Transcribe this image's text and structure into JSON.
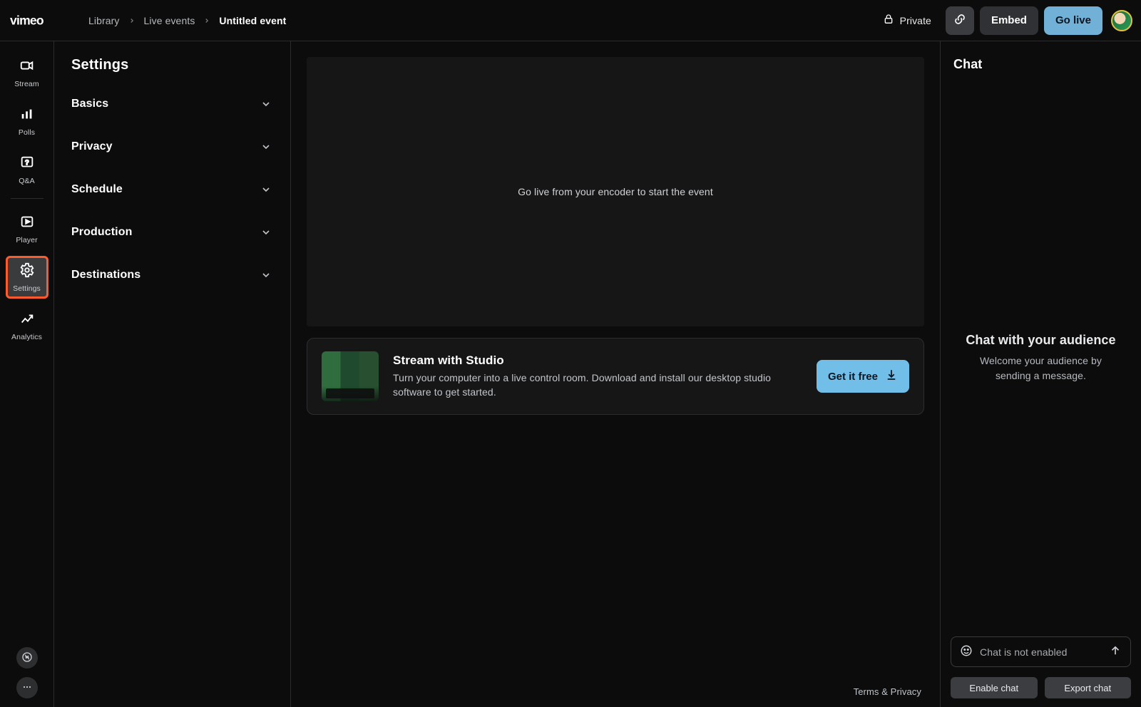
{
  "brand": {
    "name": "vimeo"
  },
  "breadcrumbs": {
    "library": "Library",
    "live_events": "Live events",
    "current": "Untitled event"
  },
  "header": {
    "private_label": "Private",
    "embed_label": "Embed",
    "go_live_label": "Go live"
  },
  "rail": {
    "items": [
      {
        "key": "stream",
        "label": "Stream"
      },
      {
        "key": "polls",
        "label": "Polls"
      },
      {
        "key": "qa",
        "label": "Q&A"
      },
      {
        "key": "player",
        "label": "Player"
      },
      {
        "key": "settings",
        "label": "Settings",
        "active": true,
        "highlighted": true
      },
      {
        "key": "analytics",
        "label": "Analytics"
      }
    ]
  },
  "panel": {
    "title": "Settings",
    "sections": [
      {
        "key": "basics",
        "label": "Basics"
      },
      {
        "key": "privacy",
        "label": "Privacy"
      },
      {
        "key": "schedule",
        "label": "Schedule"
      },
      {
        "key": "production",
        "label": "Production"
      },
      {
        "key": "destinations",
        "label": "Destinations"
      }
    ]
  },
  "stage": {
    "placeholder": "Go live from your encoder to start the event"
  },
  "promo": {
    "title": "Stream with Studio",
    "desc": "Turn your computer into a live control room. Download and install our desktop studio software to get started.",
    "cta": "Get it free"
  },
  "footer": {
    "terms": "Terms & Privacy"
  },
  "chat": {
    "title": "Chat",
    "empty_title": "Chat with your audience",
    "empty_desc": "Welcome your audience by sending a message.",
    "input_placeholder": "Chat is not enabled",
    "enable": "Enable chat",
    "export": "Export chat"
  },
  "colors": {
    "accent": "#7ec3ee",
    "highlight": "#ff5a2d"
  }
}
